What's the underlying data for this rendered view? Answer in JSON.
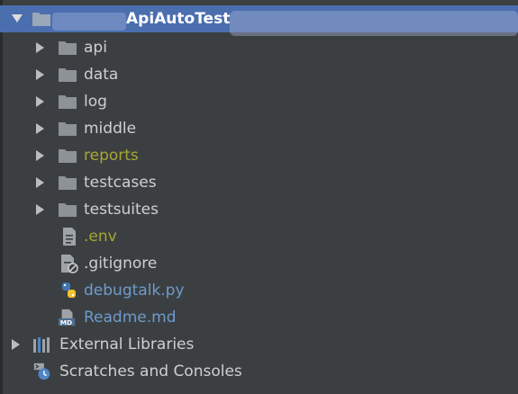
{
  "project_tree": {
    "root": {
      "label": "ApiAutoTest",
      "expanded": true
    },
    "folders": [
      {
        "label": "api"
      },
      {
        "label": "data"
      },
      {
        "label": "log"
      },
      {
        "label": "middle"
      },
      {
        "label": "reports"
      },
      {
        "label": "testcases"
      },
      {
        "label": "testsuites"
      }
    ],
    "files": [
      {
        "label": ".env",
        "icon": "text-file-icon"
      },
      {
        "label": ".gitignore",
        "icon": "ignored-file-icon"
      },
      {
        "label": "debugtalk.py",
        "icon": "python-file-icon"
      },
      {
        "label": "Readme.md",
        "icon": "markdown-file-icon"
      }
    ],
    "external_libraries": {
      "label": "External Libraries"
    },
    "scratches": {
      "label": "Scratches and Consoles"
    }
  },
  "colors": {
    "background": "#3c3f41",
    "selection": "#4b6eaf",
    "folder": "#8c9297",
    "modified_text": "#a6a832",
    "new_text": "#6d9bcd",
    "normal_text": "#cfcfcf"
  }
}
